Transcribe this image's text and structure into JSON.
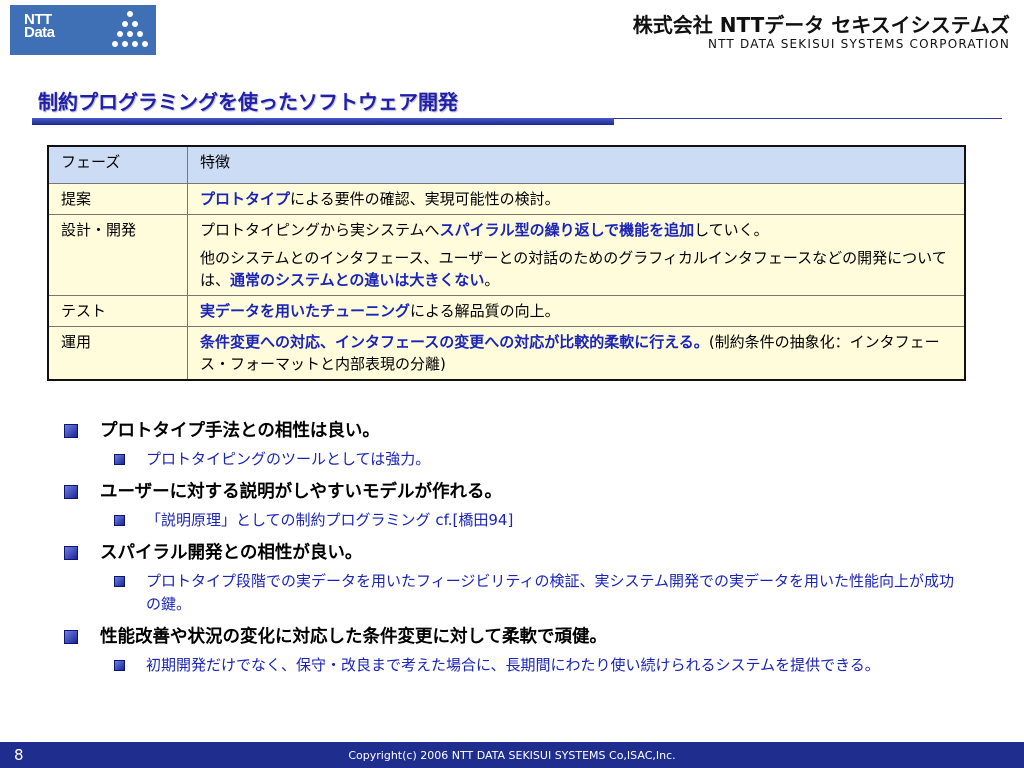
{
  "header": {
    "logo_line1": "NTT",
    "logo_line2": "Data",
    "company_jp": "株式会社 NTTデータ セキスイシステムズ",
    "company_en": "NTT DATA SEKISUI SYSTEMS CORPORATION"
  },
  "title": "制約プログラミングを使ったソフトウェア開発",
  "table": {
    "headers": [
      "フェーズ",
      "特徴"
    ],
    "rows": [
      {
        "phase": "提案",
        "p1": [
          {
            "t": "プロトタイプ",
            "em": true
          },
          {
            "t": "による要件の確認、実現可能性の検討。",
            "em": false
          }
        ]
      },
      {
        "phase": "設計・開発",
        "p1": [
          {
            "t": "プロトタイピングから実システムへ",
            "em": false
          },
          {
            "t": "スパイラル型の繰り返しで機能を追加",
            "em": true
          },
          {
            "t": "していく。",
            "em": false
          }
        ],
        "p2": [
          {
            "t": "他のシステムとのインタフェース、ユーザーとの対話のためのグラフィカルインタフェースなどの開発については、",
            "em": false
          },
          {
            "t": "通常のシステムとの違いは大きくない",
            "em": true
          },
          {
            "t": "。",
            "em": false
          }
        ]
      },
      {
        "phase": "テスト",
        "p1": [
          {
            "t": "実データを用いたチューニング",
            "em": true
          },
          {
            "t": "による解品質の向上。",
            "em": false
          }
        ]
      },
      {
        "phase": "運用",
        "p1": [
          {
            "t": "条件変更への対応、インタフェースの変更への対応が比較的柔軟に行える。",
            "em": true
          },
          {
            "t": "(制約条件の抽象化：インタフェース・フォーマットと内部表現の分離)",
            "em": false
          }
        ]
      }
    ]
  },
  "bullets": [
    {
      "text": "プロトタイプ手法との相性は良い。",
      "sub": "プロトタイピングのツールとしては強力。"
    },
    {
      "text": "ユーザーに対する説明がしやすいモデルが作れる。",
      "sub": "「説明原理」としての制約プログラミング cf.[橋田94]"
    },
    {
      "text": "スパイラル開発との相性が良い。",
      "sub": "プロトタイプ段階での実データを用いたフィージビリティの検証、実システム開発での実データを用いた性能向上が成功の鍵。"
    },
    {
      "text": "性能改善や状況の変化に対応した条件変更に対して柔軟で頑健。",
      "sub": "初期開発だけでなく、保守・改良まで考えた場合に、長期間にわたり使い続けられるシステムを提供できる。"
    }
  ],
  "footer": {
    "page": "8",
    "copyright": "Copyright(c) 2006 NTT DATA SEKISUI SYSTEMS Co,ISAC,Inc."
  }
}
